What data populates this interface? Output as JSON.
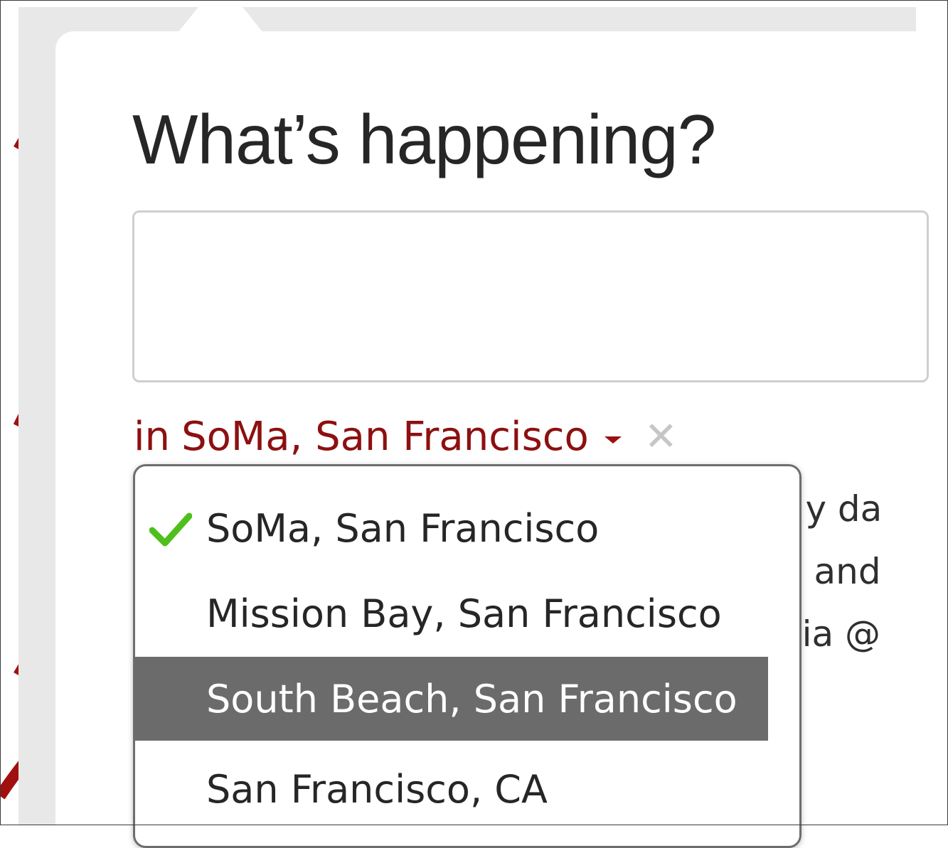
{
  "composer": {
    "heading": "What’s happening?",
    "tweet_value": "",
    "tweet_placeholder": ""
  },
  "location": {
    "prefix": "in",
    "selected": "SoMa, San Francisco",
    "clear_glyph": "✕",
    "accent_color": "#8d1010"
  },
  "dropdown": {
    "items": [
      {
        "label": "SoMa, San Francisco",
        "checked": true
      },
      {
        "label": "Mission Bay, San Francisco",
        "checked": false
      },
      {
        "label": "South Beach, San Francisco",
        "checked": false,
        "highlighted": true
      },
      {
        "label": "San Francisco, CA",
        "checked": false
      }
    ],
    "check_color": "#4fbf1c",
    "highlight_color": "#6b6b6b"
  },
  "background_tweet": {
    "lines": [
      "rly da",
      "o and",
      "via @"
    ]
  },
  "icons": [
    "check-icon",
    "caret-down-icon",
    "close-icon"
  ]
}
